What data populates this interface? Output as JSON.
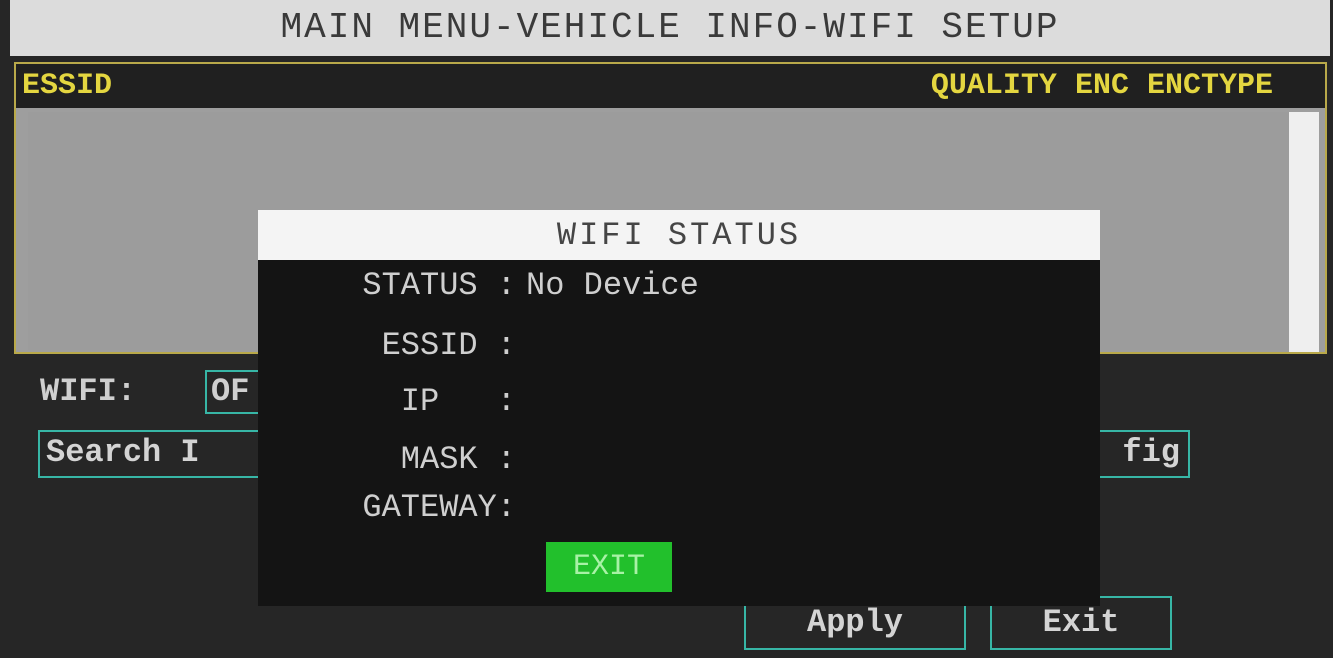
{
  "header": {
    "title": "MAIN MENU-VEHICLE INFO-WIFI SETUP"
  },
  "network_list": {
    "columns": {
      "essid": "ESSID",
      "quality": "QUALITY",
      "enc": "ENC",
      "enctype": "ENCTYPE"
    },
    "rows": []
  },
  "wifi": {
    "label": "WIFI:",
    "toggle_value": "OF"
  },
  "buttons": {
    "search": "Search I",
    "config": "fig",
    "apply": "Apply",
    "exit": "Exit"
  },
  "dialog": {
    "title": "WIFI STATUS",
    "fields": [
      {
        "label": "STATUS :",
        "value": "No Device"
      },
      {
        "label": "ESSID :",
        "value": ""
      },
      {
        "label": "IP   :",
        "value": ""
      },
      {
        "label": "MASK :",
        "value": ""
      },
      {
        "label": "GATEWAY:",
        "value": ""
      }
    ],
    "exit_label": "EXIT"
  },
  "colors": {
    "header_text": "#e4d640",
    "button_border": "#37b6a6",
    "dialog_exit_bg": "#22c02c"
  }
}
